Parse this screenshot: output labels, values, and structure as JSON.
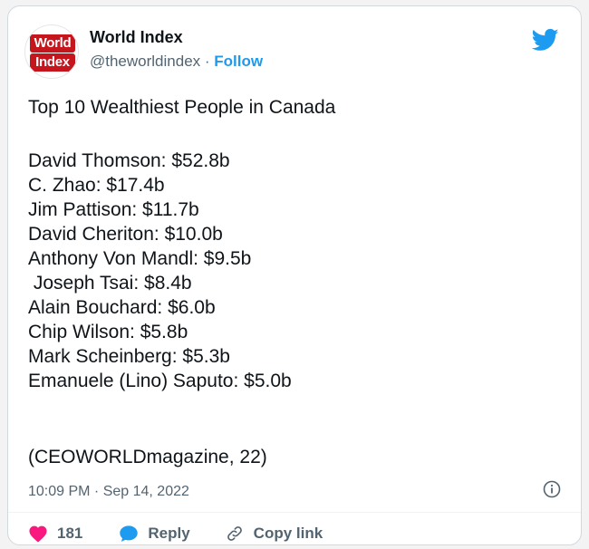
{
  "account": {
    "logo_top": "World",
    "logo_bottom": "Index",
    "name": "World Index",
    "handle": "@theworldindex",
    "separator": " · ",
    "follow_label": "Follow"
  },
  "tweet": {
    "title": "Top 10 Wealthiest People in Canada",
    "list": [
      "David Thomson: $52.8b",
      "C. Zhao: $17.4b",
      "Jim Pattison: $11.7b",
      "David Cheriton: $10.0b",
      "Anthony Von Mandl: $9.5b",
      " Joseph Tsai: $8.4b",
      "Alain Bouchard: $6.0b",
      "Chip Wilson: $5.8b",
      "Mark Scheinberg: $5.3b",
      "Emanuele (Lino) Saputo: $5.0b"
    ],
    "source": "(CEOWORLDmagazine, 22)",
    "timestamp": "10:09 PM · Sep 14, 2022"
  },
  "actions": {
    "like_count": "181",
    "reply_label": "Reply",
    "copy_label": "Copy link"
  },
  "colors": {
    "brand_red": "#c4161c",
    "twitter_blue": "#1d9bf0",
    "like_red": "#f91880",
    "muted_text": "#536471"
  },
  "icons": [
    "twitter-bird-icon",
    "info-icon",
    "heart-icon",
    "reply-bubble-icon",
    "link-icon"
  ]
}
